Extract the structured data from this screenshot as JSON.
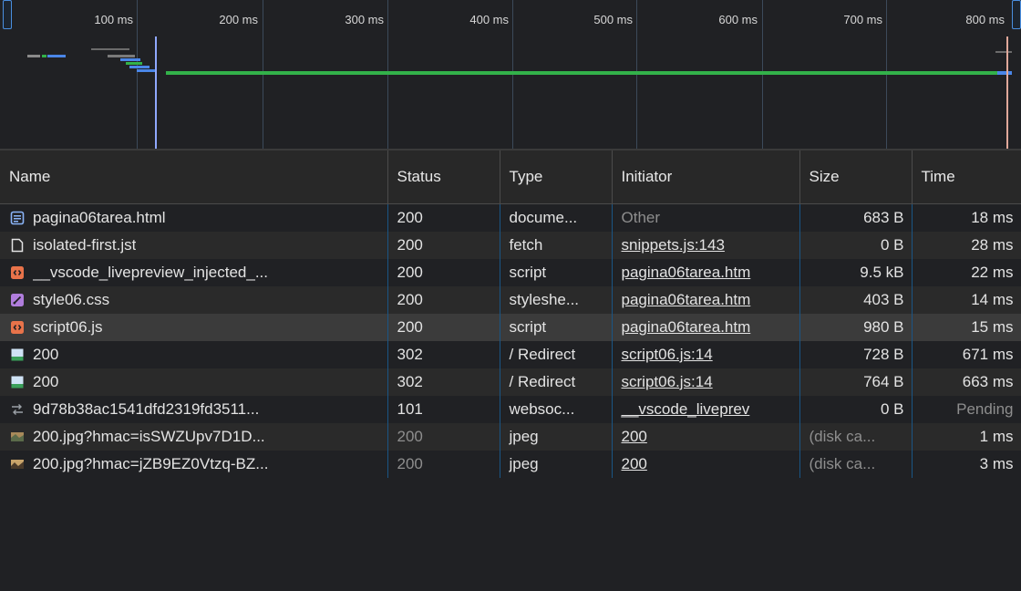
{
  "timeline": {
    "ticks": [
      "100 ms",
      "200 ms",
      "300 ms",
      "400 ms",
      "500 ms",
      "600 ms",
      "700 ms",
      "800 ms"
    ]
  },
  "columns": {
    "name": "Name",
    "status": "Status",
    "type": "Type",
    "initiator": "Initiator",
    "size": "Size",
    "time": "Time"
  },
  "requests": [
    {
      "icon": "document-icon",
      "name": "pagina06tarea.html",
      "status": "200",
      "type": "docume...",
      "initiator": "Other",
      "size": "683 B",
      "time": "18 ms"
    },
    {
      "icon": "file-icon",
      "name": "isolated-first.jst",
      "status": "200",
      "type": "fetch",
      "initiator": "snippets.js:143",
      "size": "0 B",
      "time": "28 ms"
    },
    {
      "icon": "script-icon",
      "name": "__vscode_livepreview_injected_...",
      "status": "200",
      "type": "script",
      "initiator": "pagina06tarea.htm",
      "size": "9.5 kB",
      "time": "22 ms"
    },
    {
      "icon": "stylesheet-icon",
      "name": "style06.css",
      "status": "200",
      "type": "styleshe...",
      "initiator": "pagina06tarea.htm",
      "size": "403 B",
      "time": "14 ms"
    },
    {
      "icon": "script-icon",
      "name": "script06.js",
      "status": "200",
      "type": "script",
      "initiator": "pagina06tarea.htm",
      "size": "980 B",
      "time": "15 ms"
    },
    {
      "icon": "image-icon",
      "name": "200",
      "status": "302",
      "type": "/ Redirect",
      "initiator": "script06.js:14",
      "size": "728 B",
      "time": "671 ms"
    },
    {
      "icon": "image-icon",
      "name": "200",
      "status": "302",
      "type": "/ Redirect",
      "initiator": "script06.js:14",
      "size": "764 B",
      "time": "663 ms"
    },
    {
      "icon": "websocket-icon",
      "name": "9d78b38ac1541dfd2319fd3511...",
      "status": "101",
      "type": "websoc...",
      "initiator": "__vscode_liveprev",
      "size": "0 B",
      "time": "Pending"
    },
    {
      "icon": "image-thumbnail-icon",
      "name": "200.jpg?hmac=isSWZUpv7D1D...",
      "status": "200",
      "type": "jpeg",
      "initiator": "200",
      "size": "(disk ca...",
      "time": "1 ms"
    },
    {
      "icon": "image-thumbnail-icon",
      "name": "200.jpg?hmac=jZB9EZ0Vtzq-BZ...",
      "status": "200",
      "type": "jpeg",
      "initiator": "200",
      "size": "(disk ca...",
      "time": "3 ms"
    }
  ]
}
